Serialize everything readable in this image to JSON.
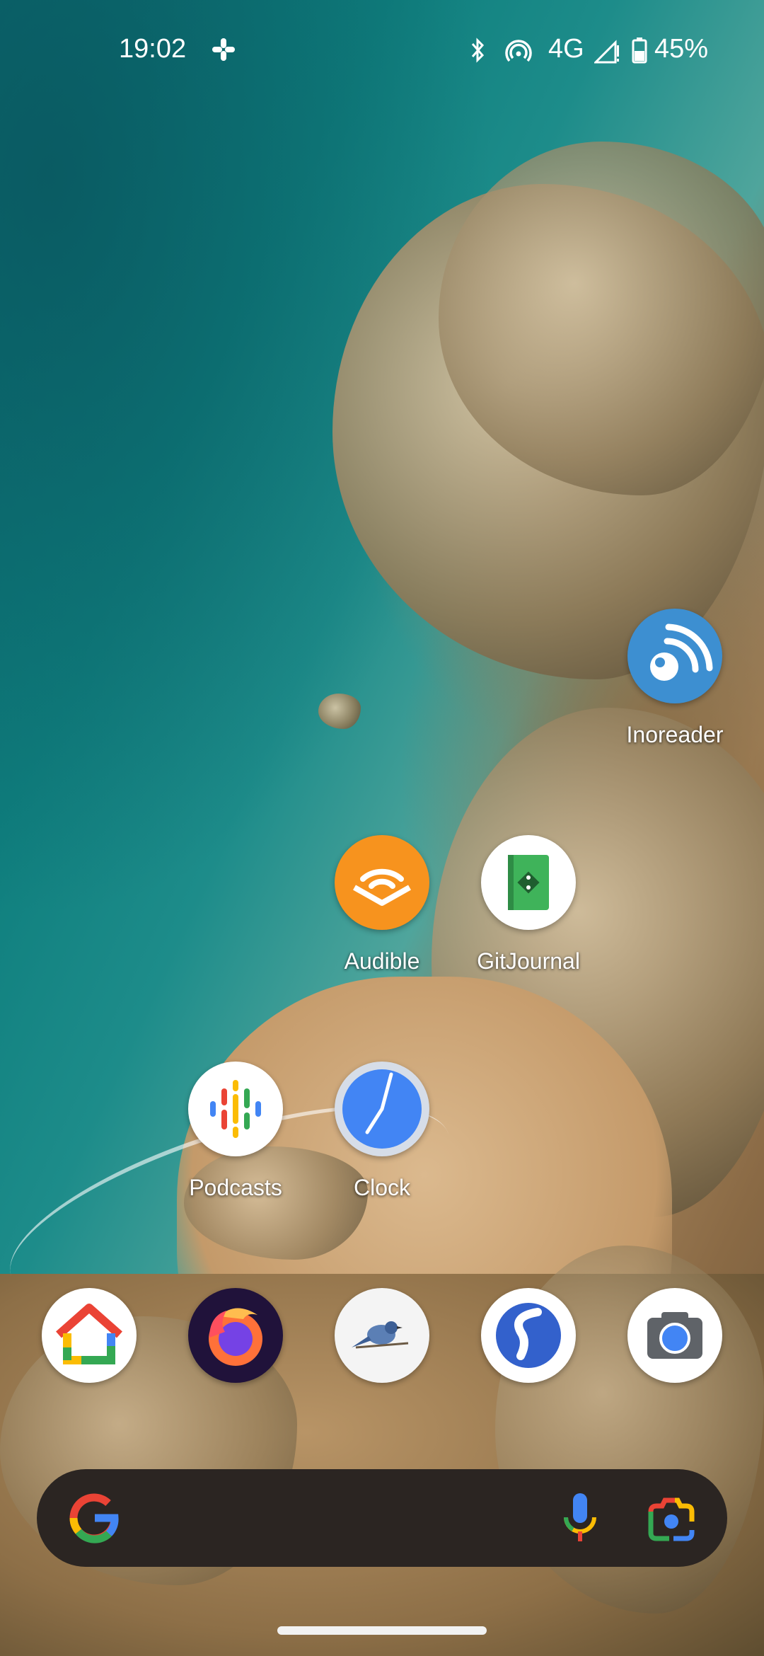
{
  "status_bar": {
    "time": "19:02",
    "notification_icon": "slack-icon",
    "bluetooth_icon": "bluetooth-icon",
    "hotspot_icon": "hotspot-icon",
    "network": "4G",
    "signal_icon": "signal-icon",
    "battery_icon": "battery-icon",
    "battery": "45%"
  },
  "apps": [
    {
      "id": "inoreader",
      "label": "Inoreader",
      "icon": "inoreader-icon"
    },
    {
      "id": "audible",
      "label": "Audible",
      "icon": "audible-icon"
    },
    {
      "id": "gitjournal",
      "label": "GitJournal",
      "icon": "gitjournal-icon"
    },
    {
      "id": "podcasts",
      "label": "Podcasts",
      "icon": "podcasts-icon"
    },
    {
      "id": "clock",
      "label": "Clock",
      "icon": "clock-icon"
    }
  ],
  "dock": [
    {
      "id": "google-home",
      "icon": "google-home-icon"
    },
    {
      "id": "firefox",
      "icon": "firefox-icon"
    },
    {
      "id": "bird-app",
      "icon": "bluejay-icon"
    },
    {
      "id": "simplenote",
      "icon": "simplenote-icon"
    },
    {
      "id": "camera",
      "icon": "camera-icon"
    }
  ],
  "search_bar": {
    "google_icon": "google-g-icon",
    "mic_icon": "microphone-icon",
    "lens_icon": "google-lens-icon"
  },
  "colors": {
    "inoreader": "#3d8fd1",
    "audible": "#f7931e",
    "gitjournal": "#3fb35a",
    "clock_face": "#4285f4",
    "search_bar": "#2b2522",
    "simplenote": "#3361cc"
  }
}
